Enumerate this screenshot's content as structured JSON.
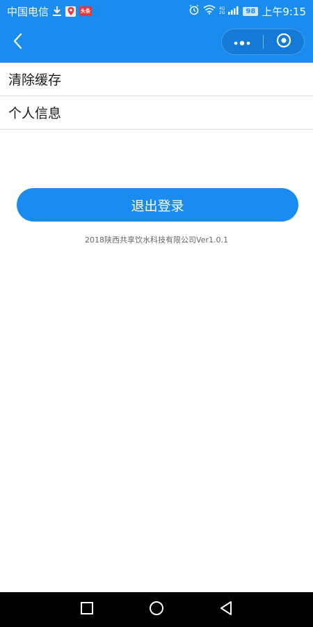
{
  "status_bar": {
    "carrier": "中国电信",
    "notification_news": "头条",
    "battery": "98",
    "network_top": "4G",
    "network_bottom": "2G",
    "time": "上午9:15",
    "color": "#1a8cf0"
  },
  "nav": {
    "back_icon": "chevron-left-icon",
    "more_icon": "more-dots-icon",
    "close_icon": "target-circle-icon"
  },
  "menu": {
    "items": [
      {
        "label": "清除缓存"
      },
      {
        "label": "个人信息"
      }
    ]
  },
  "logout": {
    "label": "退出登录",
    "color": "#1a8cf0"
  },
  "footer": {
    "version": "2018陕西共享饮水科技有限公司Ver1.0.1"
  },
  "system_nav": {
    "recent_icon": "square-recent-icon",
    "home_icon": "circle-home-icon",
    "back_icon": "triangle-back-icon"
  }
}
